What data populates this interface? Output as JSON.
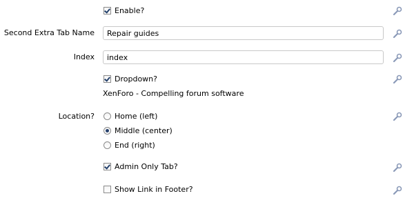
{
  "options": {
    "enable": {
      "label": "Enable?",
      "checked": true
    },
    "second_tab_name": {
      "label": "Second Extra Tab Name",
      "value": "Repair guides"
    },
    "index": {
      "label": "Index",
      "value": "index"
    },
    "dropdown": {
      "label": "Dropdown?",
      "checked": true,
      "explain": "XenForo - Compelling forum software"
    },
    "location": {
      "label": "Location?",
      "options": [
        {
          "label": "Home (left)",
          "checked": false
        },
        {
          "label": "Middle (center)",
          "checked": true
        },
        {
          "label": "End (right)",
          "checked": false
        }
      ]
    },
    "admin_only": {
      "label": "Admin Only Tab?",
      "checked": true
    },
    "footer_link": {
      "label": "Show Link in Footer?",
      "checked": false
    }
  },
  "icons": {
    "edit": "wrench-icon"
  },
  "colors": {
    "input_border": "#c8c8c8",
    "check_mark": "#23406b",
    "wrench": "#9aaac4"
  }
}
